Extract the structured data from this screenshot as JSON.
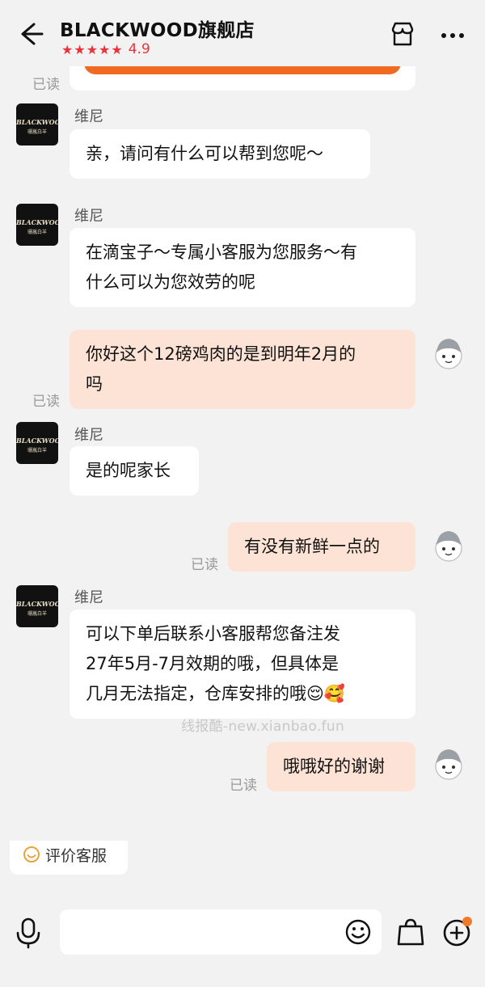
{
  "header": {
    "shop_name": "BLACKWOOD旗舰店",
    "stars": "★★★★★",
    "rating": "4.9"
  },
  "brand_logo": {
    "text": "BLACKWOOD",
    "subtext": "珊嵐白羊"
  },
  "messages": [
    {
      "side": "in",
      "sender": "维尼",
      "text": "亲，请问有什么可以帮到您呢～"
    },
    {
      "side": "in",
      "sender": "维尼",
      "lines": [
        "在滴宝子～专属小客服为您服务～有",
        "什么可以为您效劳的呢"
      ]
    },
    {
      "side": "out",
      "lines": [
        "你好这个12磅鸡肉的是到明年2月的",
        "吗"
      ],
      "status": "已读"
    },
    {
      "side": "in",
      "sender": "维尼",
      "text": "是的呢家长"
    },
    {
      "side": "out",
      "text": "有没有新鲜一点的",
      "status": "已读"
    },
    {
      "side": "in",
      "sender": "维尼",
      "lines": [
        "可以下单后联系小客服帮您备注发",
        "27年5月-7月效期的哦，但具体是",
        "几月无法指定，仓库安排的哦😌🥰"
      ]
    },
    {
      "side": "out",
      "text": "哦哦好的谢谢",
      "status": "已读"
    }
  ],
  "previous_status": "已读",
  "watermark": "线报酷-new.xianbao.fun",
  "rate_service": "评价客服",
  "colors": {
    "accent": "#e8333b",
    "out_bubble": "#fce3d5",
    "orange": "#f06a22"
  },
  "icons": [
    "back-arrow-icon",
    "store-icon",
    "more-icon",
    "mic-icon",
    "emoji-icon",
    "bag-icon",
    "plus-icon",
    "smile-icon"
  ]
}
